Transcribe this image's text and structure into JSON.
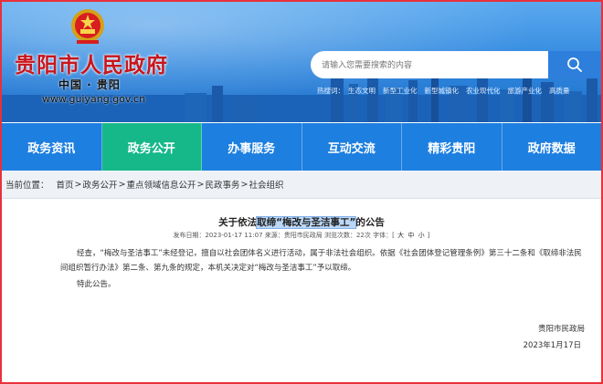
{
  "header": {
    "site_title": "贵阳市人民政府",
    "site_sub": "中国 · 贵阳",
    "site_url": "www.guiyang.gov.cn",
    "search_placeholder": "请输入您需要搜索的内容",
    "hot_label": "热搜词：",
    "hot_words": [
      "生态文明",
      "新型工业化",
      "新型城镇化",
      "农业现代化",
      "旅游产业化",
      "高质量"
    ]
  },
  "nav": {
    "items": [
      "政务资讯",
      "政务公开",
      "办事服务",
      "互动交流",
      "精彩贵阳",
      "政府数据"
    ],
    "active_index": 1
  },
  "breadcrumb": {
    "label": "当前位置：",
    "items": [
      "首页",
      "政务公开",
      "重点领域信息公开",
      "民政事务",
      "社会组织"
    ]
  },
  "article": {
    "title_pre": "关于依法",
    "title_hl": "取缔“梅改与圣洁事工”",
    "title_post": "的公告",
    "meta_pre": "发布日期：2023-01-17 11:07 来源：贵阳市民政局 浏览次数：22次 字体：[",
    "font_big": "大",
    "font_mid": "中",
    "font_small": "小",
    "meta_post": "]",
    "para1": "经查，“梅改与圣洁事工”未经登记，擅自以社会团体名义进行活动，属于非法社会组织。依据《社会团体登记管理条例》第三十二条和《取缔非法民间组织暂行办法》第二条、第九条的规定，本机关决定对“梅改与圣洁事工”予以取缔。",
    "para2": "特此公告。",
    "sign_org": "贵阳市民政局",
    "sign_date": "2023年1月17日"
  },
  "colors": {
    "frame": "#e8313b",
    "nav": "#1d7fe0",
    "nav_active": "#16b88a",
    "title_red": "#c8161d"
  }
}
